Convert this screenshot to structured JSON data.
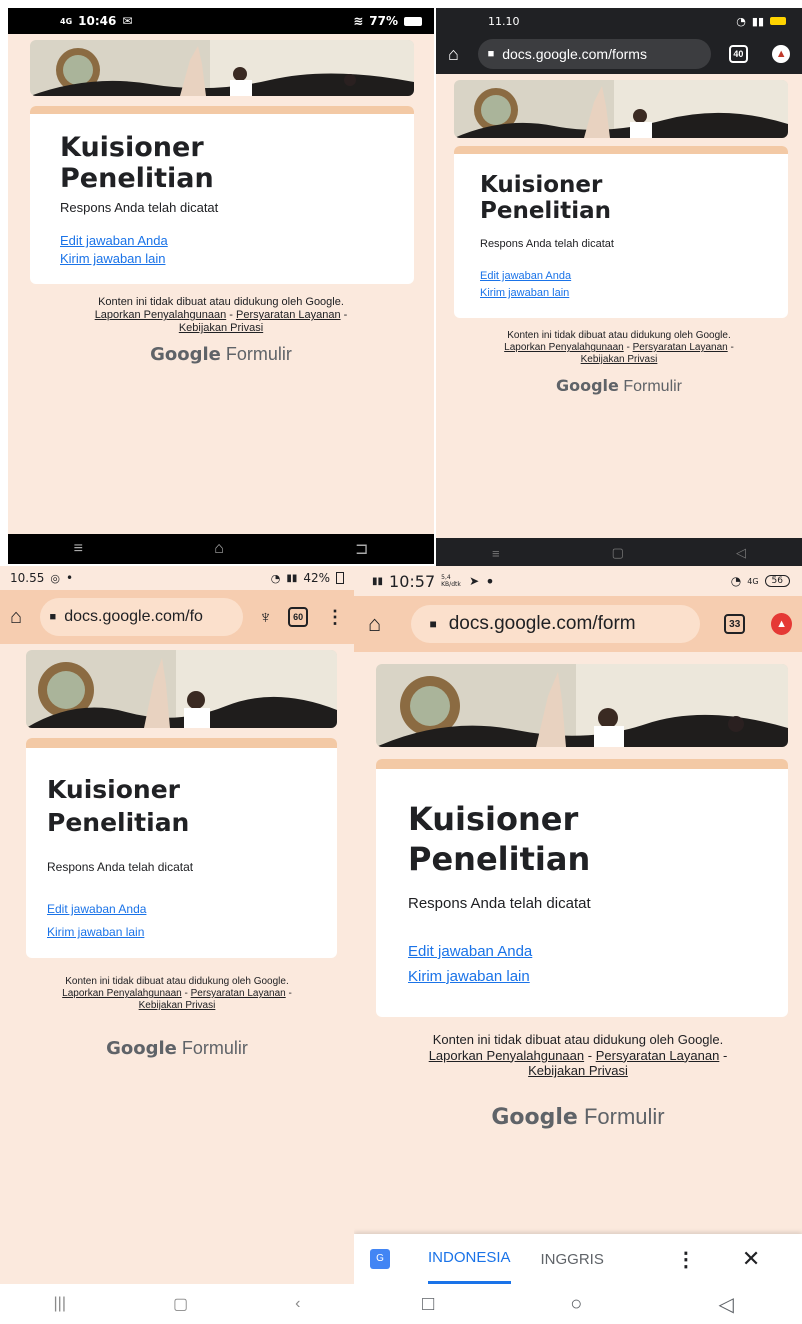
{
  "form": {
    "title_line1": "Kuisioner",
    "title_line2": "Penelitian",
    "response_text": "Respons Anda telah dicatat",
    "edit_link": "Edit jawaban Anda",
    "another_link": "Kirim jawaban lain",
    "disclaimer": "Konten ini tidak dibuat atau didukung oleh Google.",
    "report_link": "Laporkan Penyalahgunaan",
    "terms_link": "Persyaratan Layanan",
    "privacy_link": "Kebijakan Privasi",
    "separator": "-",
    "brand_google": "Google",
    "brand_forms": "Formulir"
  },
  "phone1": {
    "signal": "4G",
    "time": "10:46",
    "battery": "77%"
  },
  "phone2": {
    "time": "11.10",
    "url": "docs.google.com/forms",
    "tabs": "40"
  },
  "phone3": {
    "time": "10.55",
    "battery": "42%",
    "url": "docs.google.com/fo",
    "tabs": "60"
  },
  "phone4": {
    "time": "10:57",
    "speed": "5,4 KB/dtk",
    "battery": "56",
    "url": "docs.google.com/form",
    "tabs": "33",
    "translate_lang1": "INDONESIA",
    "translate_lang2": "INGGRIS"
  },
  "colors": {
    "page_bg": "#fbe9dd",
    "card_accent": "#f3c9a5",
    "link": "#1a73e8",
    "url_bar_dark": "#202124",
    "url_bar_peach": "#f6cdb0"
  }
}
